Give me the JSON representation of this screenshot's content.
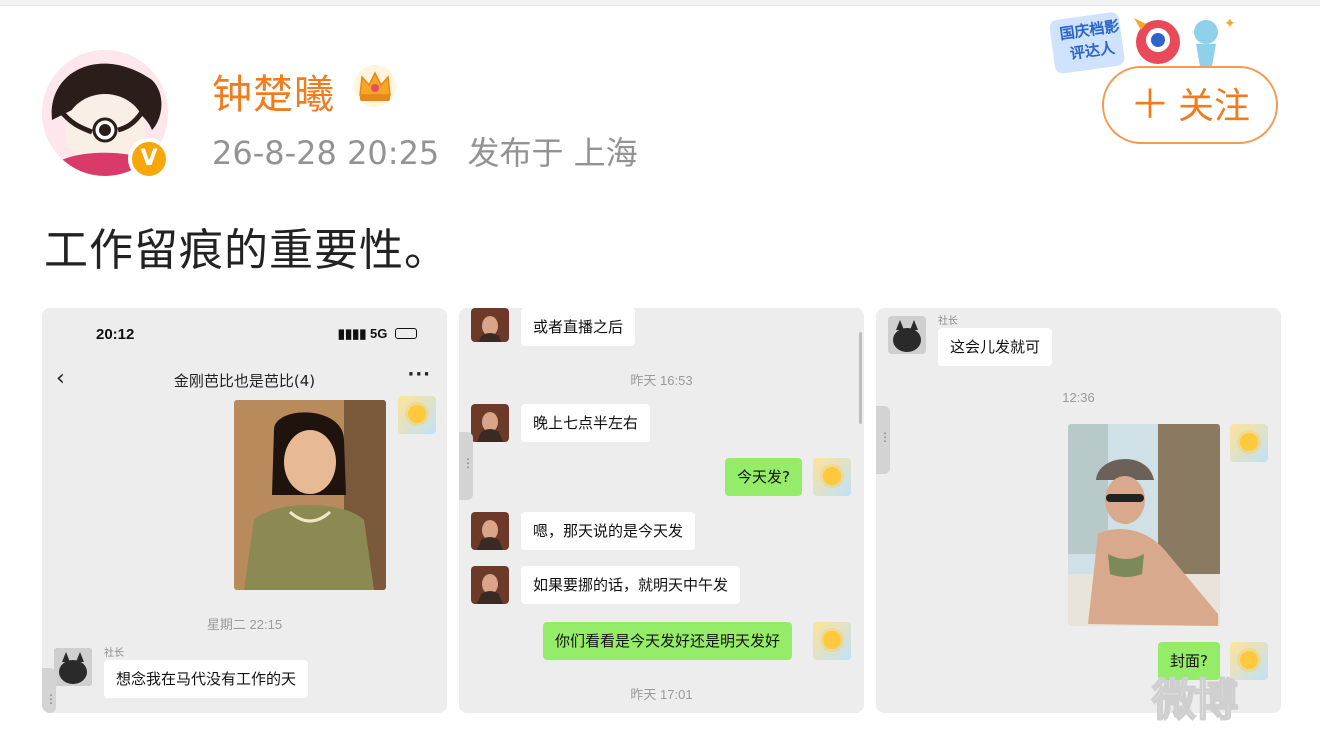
{
  "post": {
    "username": "钟楚曦",
    "datetime": "26-8-28 20:25",
    "location": "发布于 上海",
    "text": "工作留痕的重要性。",
    "follow_label": "关注",
    "follow_plus": "＋",
    "verified_badge": "V",
    "badge_text": "国庆档影评达人"
  },
  "shot1": {
    "status_time": "20:12",
    "status_signal": "5G",
    "back_icon": "‹",
    "title": "金刚芭比也是芭比(4)",
    "more_icon": "···",
    "timestamp": "星期二 22:15",
    "sender": "社长",
    "message": "想念我在马代没有工作的天"
  },
  "shot2": {
    "msg1": "或者直播之后",
    "time1": "昨天 16:53",
    "msg2": "晚上七点半左右",
    "msg3": "今天发?",
    "msg4": "嗯，那天说的是今天发",
    "msg5": "如果要挪的话，就明天中午发",
    "msg6": "你们看看是今天发好还是明天发好",
    "time2": "昨天 17:01"
  },
  "shot3": {
    "sender": "社长",
    "msg1": "这会儿发就可",
    "time1": "12:36",
    "msg2": "封面?"
  },
  "watermark": "微博",
  "colors": {
    "accent": "#f07c20",
    "chat_green": "#95ec69",
    "chat_bg": "#ededed",
    "meta_grey": "#939393"
  }
}
